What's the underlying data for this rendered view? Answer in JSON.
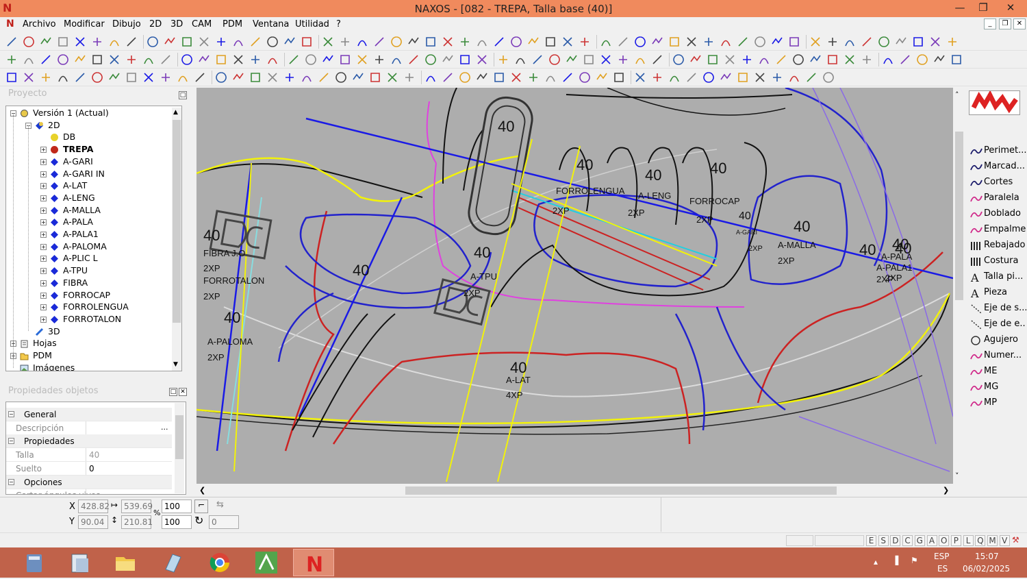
{
  "window": {
    "title": "NAXOS - [082 - TREPA, Talla base (40)]",
    "logo": "N",
    "minimize": "—",
    "maximize": "❐",
    "close": "✕"
  },
  "menu": {
    "items": [
      "Archivo",
      "Modificar",
      "Dibujo",
      "2D",
      "3D",
      "CAM",
      "PDM",
      "Ventana",
      "Utilidad",
      "?"
    ]
  },
  "project_panel": {
    "title": "Proyecto",
    "tree": [
      {
        "label": "Versión 1 (Actual)",
        "level": 0,
        "expander": "−",
        "icon": "version-icon"
      },
      {
        "label": "2D",
        "level": 1,
        "expander": "−",
        "icon": "2d-folder-icon"
      },
      {
        "label": "DB",
        "level": 2,
        "expander": "",
        "icon": "yellow-dot-icon"
      },
      {
        "label": "TREPA",
        "level": 2,
        "expander": "+",
        "icon": "red-dot-icon",
        "bold": true
      },
      {
        "label": "A-GARI",
        "level": 2,
        "expander": "+",
        "icon": "blue-diamond-icon"
      },
      {
        "label": "A-GARI IN",
        "level": 2,
        "expander": "+",
        "icon": "blue-diamond-icon"
      },
      {
        "label": "A-LAT",
        "level": 2,
        "expander": "+",
        "icon": "blue-diamond-icon"
      },
      {
        "label": "A-LENG",
        "level": 2,
        "expander": "+",
        "icon": "blue-diamond-icon"
      },
      {
        "label": "A-MALLA",
        "level": 2,
        "expander": "+",
        "icon": "blue-diamond-icon"
      },
      {
        "label": "A-PALA",
        "level": 2,
        "expander": "+",
        "icon": "blue-diamond-icon"
      },
      {
        "label": "A-PALA1",
        "level": 2,
        "expander": "+",
        "icon": "blue-diamond-icon"
      },
      {
        "label": "A-PALOMA",
        "level": 2,
        "expander": "+",
        "icon": "blue-diamond-icon"
      },
      {
        "label": "A-PLIC L",
        "level": 2,
        "expander": "+",
        "icon": "blue-diamond-icon"
      },
      {
        "label": "A-TPU",
        "level": 2,
        "expander": "+",
        "icon": "blue-diamond-icon"
      },
      {
        "label": "FIBRA",
        "level": 2,
        "expander": "+",
        "icon": "blue-diamond-icon"
      },
      {
        "label": "FORROCAP",
        "level": 2,
        "expander": "+",
        "icon": "blue-diamond-icon"
      },
      {
        "label": "FORROLENGUA",
        "level": 2,
        "expander": "+",
        "icon": "blue-diamond-icon"
      },
      {
        "label": "FORROTALON",
        "level": 2,
        "expander": "+",
        "icon": "blue-diamond-icon"
      },
      {
        "label": "3D",
        "level": 1,
        "expander": "",
        "icon": "3d-icon"
      },
      {
        "label": "Hojas",
        "level": 0,
        "expander": "+",
        "icon": "sheets-icon"
      },
      {
        "label": "PDM",
        "level": 0,
        "expander": "+",
        "icon": "folder-icon"
      },
      {
        "label": "Imágenes",
        "level": 0,
        "expander": "",
        "icon": "images-icon"
      }
    ]
  },
  "properties_panel": {
    "title": "Propiedades objetos",
    "rows": [
      {
        "type": "group",
        "label": "General"
      },
      {
        "type": "field",
        "label": "Descripción",
        "value": "",
        "button": "..."
      },
      {
        "type": "group",
        "label": "Propiedades"
      },
      {
        "type": "field",
        "label": "Talla",
        "value": "40"
      },
      {
        "type": "field",
        "label": "Suelto",
        "value": "0"
      },
      {
        "type": "group",
        "label": "Opciones"
      },
      {
        "type": "field",
        "label": "Cortar ángulos vivos",
        "value": ""
      }
    ]
  },
  "canvas": {
    "labels": [
      {
        "text": "40",
        "size": 22
      },
      {
        "text": "FIBRA J.O",
        "size": 13
      },
      {
        "text": "2XP",
        "size": 13
      },
      {
        "text": "FORROTALON",
        "size": 13
      },
      {
        "text": "2XP",
        "size": 13
      },
      {
        "text": "40",
        "size": 22
      },
      {
        "text": "A-PALOMA",
        "size": 13
      },
      {
        "text": "2XP",
        "size": 13
      },
      {
        "text": "40",
        "size": 22
      },
      {
        "text": "40",
        "size": 22
      },
      {
        "text": "A-TPU",
        "size": 13
      },
      {
        "text": "2XP",
        "size": 13
      },
      {
        "text": "40",
        "size": 22
      },
      {
        "text": "40",
        "size": 22
      },
      {
        "text": "FORROLENGUA",
        "size": 13
      },
      {
        "text": "2XP",
        "size": 13
      },
      {
        "text": "40",
        "size": 22
      },
      {
        "text": "A-LENG",
        "size": 13
      },
      {
        "text": "2XP",
        "size": 13
      },
      {
        "text": "40",
        "size": 22
      },
      {
        "text": "FORROCAP",
        "size": 13
      },
      {
        "text": "2XP",
        "size": 13
      },
      {
        "text": "40",
        "size": 16
      },
      {
        "text": "40",
        "size": 22
      },
      {
        "text": "A-MALLA",
        "size": 13
      },
      {
        "text": "2XP",
        "size": 13
      },
      {
        "text": "40",
        "size": 22
      },
      {
        "text": "40",
        "size": 22
      },
      {
        "text": "A-PALA",
        "size": 13
      },
      {
        "text": "A-PALA1",
        "size": 13
      },
      {
        "text": "2XP",
        "size": 13
      },
      {
        "text": "2XP",
        "size": 13
      },
      {
        "text": "40",
        "size": 22
      },
      {
        "text": "A-LAT",
        "size": 13
      },
      {
        "text": "4XP",
        "size": 13
      },
      {
        "text": "40",
        "size": 22
      },
      {
        "text": "2XP",
        "size": 11
      },
      {
        "text": "A-GARI",
        "size": 9
      }
    ]
  },
  "right_tools": [
    {
      "label": "Perimet...",
      "icon": "perimeter-icon"
    },
    {
      "label": "Marcad...",
      "icon": "marker-icon"
    },
    {
      "label": "Cortes",
      "icon": "cuts-icon"
    },
    {
      "label": "Paralela",
      "icon": "parallel-icon"
    },
    {
      "label": "Doblado",
      "icon": "fold-icon"
    },
    {
      "label": "Empalme",
      "icon": "splice-icon"
    },
    {
      "label": "Rebajado",
      "icon": "skive-icon"
    },
    {
      "label": "Costura",
      "icon": "stitch-icon"
    },
    {
      "label": "Talla pi...",
      "icon": "size-text-icon"
    },
    {
      "label": "Pieza",
      "icon": "piece-text-icon"
    },
    {
      "label": "Eje de s...",
      "icon": "axis-icon"
    },
    {
      "label": "Eje de e...",
      "icon": "axis2-icon"
    },
    {
      "label": "Agujero",
      "icon": "hole-icon"
    },
    {
      "label": "Numer...",
      "icon": "number-icon"
    },
    {
      "label": "ME",
      "icon": "me-icon"
    },
    {
      "label": "MG",
      "icon": "mg-icon"
    },
    {
      "label": "MP",
      "icon": "mp-icon"
    }
  ],
  "coords": {
    "x_label": "X",
    "y_label": "Y",
    "x": "428.82",
    "y": "90.04",
    "width": "539.69",
    "height": "210.81",
    "scale_x": "100",
    "scale_y": "100",
    "rotation": "0",
    "percent": "%"
  },
  "status_letters": [
    "E",
    "S",
    "D",
    "C",
    "G",
    "A",
    "O",
    "P",
    "L",
    "Q",
    "M",
    "V"
  ],
  "taskbar": {
    "lang1": "ESP",
    "lang2": "ES",
    "time": "15:07",
    "date": "06/02/2025"
  },
  "colors": {
    "titlebar": "#f08a5d",
    "canvas": "#adadad",
    "taskbar": "#c0624a",
    "accent_blue": "#1a1ae6",
    "accent_yellow": "#f2f20a"
  }
}
